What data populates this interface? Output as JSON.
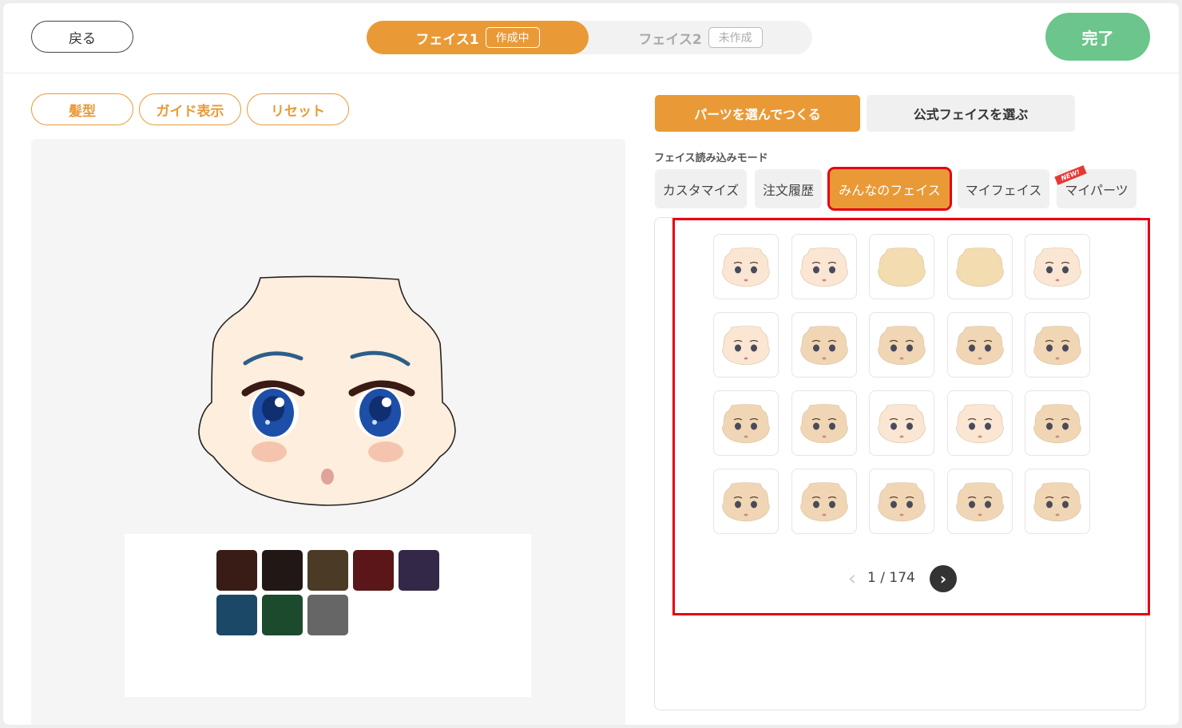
{
  "header": {
    "back_label": "戻る",
    "face_tabs": [
      {
        "label": "フェイス1",
        "badge": "作成中"
      },
      {
        "label": "フェイス2",
        "badge": "未作成"
      }
    ],
    "done_label": "完了"
  },
  "tools": {
    "hairstyle": "髪型",
    "guide": "ガイド表示",
    "reset": "リセット"
  },
  "palette": {
    "colors": [
      "#3a1c16",
      "#211816",
      "#4a3a26",
      "#5a1618",
      "#342848",
      "#1c4868",
      "#1c4a2c",
      "#666666"
    ]
  },
  "right": {
    "mode_parts": "パーツを選んでつくる",
    "mode_official": "公式フェイスを選ぶ",
    "load_mode_label": "フェイス読み込みモード",
    "sub_tabs": [
      "カスタマイズ",
      "注文履歴",
      "みんなのフェイス",
      "マイフェイス",
      "マイパーツ"
    ],
    "new_badge": "NEW!",
    "pagination": {
      "current": "1",
      "separator": "/",
      "total": "174"
    }
  },
  "icons": {
    "prev": "chevron-left-icon",
    "next": "chevron-right-icon"
  },
  "colors": {
    "accent": "#e99a36",
    "done": "#6cc58a",
    "highlight": "#e60012"
  }
}
